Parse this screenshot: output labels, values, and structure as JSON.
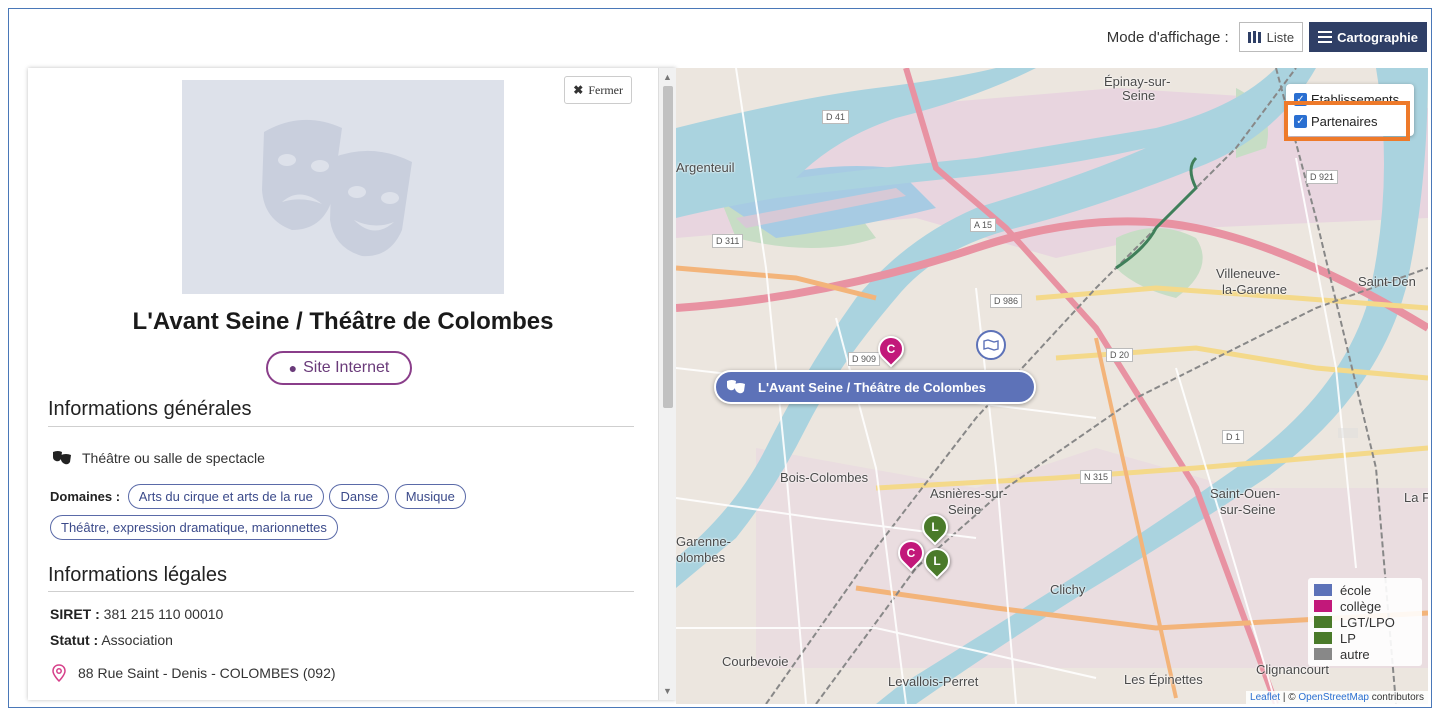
{
  "header": {
    "mode_label": "Mode d'affichage :",
    "list_button": "Liste",
    "map_button": "Cartographie"
  },
  "panel": {
    "close_label": "Fermer",
    "venue_title": "L'Avant Seine / Théâtre de Colombes",
    "website_button": "Site Internet",
    "general_info_title": "Informations générales",
    "venue_type": "Théâtre ou salle de spectacle",
    "domains_label": "Domaines :",
    "domains": [
      "Arts du cirque et arts de la rue",
      "Danse",
      "Musique",
      "Théâtre, expression dramatique, marionnettes"
    ],
    "legal_info_title": "Informations légales",
    "siret_label": "SIRET :",
    "siret_value": "381 215 110 00010",
    "status_label": "Statut :",
    "status_value": "Association",
    "address": "88 Rue Saint - Denis - COLOMBES (092)"
  },
  "map": {
    "layers": {
      "establishments": "Etablissements",
      "partners": "Partenaires"
    },
    "popup_label": "L'Avant Seine / Théâtre de Colombes",
    "place_labels": {
      "epinay": "Épinay-sur-",
      "epinay2": "Seine",
      "argenteuil": "Argenteuil",
      "villeneuve": "Villeneuve-",
      "villeneuve2": "la-Garenne",
      "saint_denis": "Saint-Den",
      "bois_colombes": "Bois-Colombes",
      "asnieres": "Asnières-sur-",
      "asnieres2": "Seine",
      "garenne": "Garenne-",
      "garenne2": "olombes",
      "saint_ouen": "Saint-Ouen-",
      "saint_ouen2": "sur-Seine",
      "clichy": "Clichy",
      "courbevoie": "Courbevoie",
      "levallois": "Levallois-Perret",
      "epinettes": "Les Épinettes",
      "clignancourt": "Clignancourt",
      "la_p": "La P"
    },
    "road_tags": [
      "D 41",
      "D 921",
      "D 311",
      "A 15",
      "D 986",
      "D 909",
      "D 20",
      "D 1",
      "N 315"
    ],
    "markers": {
      "college": "C",
      "lycee": "L"
    },
    "legend": [
      {
        "label": "école",
        "color": "#5d72b8"
      },
      {
        "label": "collège",
        "color": "#c2187a"
      },
      {
        "label": "LGT/LPO",
        "color": "#4a7a2a"
      },
      {
        "label": "LP",
        "color": "#4a7a2a"
      },
      {
        "label": "autre",
        "color": "#888888"
      }
    ],
    "attribution": {
      "leaflet": "Leaflet",
      "sep": " | © ",
      "osm": "OpenStreetMap",
      "contributors": " contributors"
    }
  }
}
